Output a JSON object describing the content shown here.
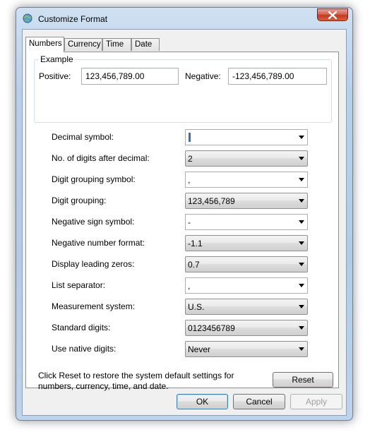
{
  "window": {
    "title": "Customize Format"
  },
  "tabs": [
    {
      "label": "Numbers",
      "active": true
    },
    {
      "label": "Currency",
      "active": false
    },
    {
      "label": "Time",
      "active": false
    },
    {
      "label": "Date",
      "active": false
    }
  ],
  "example": {
    "title": "Example",
    "positive_label": "Positive:",
    "positive_value": "123,456,789.00",
    "negative_label": "Negative:",
    "negative_value": "-123,456,789.00"
  },
  "settings": [
    {
      "label": "Decimal symbol:",
      "value": ".",
      "style": "editable"
    },
    {
      "label": "No. of digits after decimal:",
      "value": "2",
      "style": "readonly"
    },
    {
      "label": "Digit grouping symbol:",
      "value": ",",
      "style": "editable"
    },
    {
      "label": "Digit grouping:",
      "value": "123,456,789",
      "style": "readonly"
    },
    {
      "label": "Negative sign symbol:",
      "value": "-",
      "style": "editable"
    },
    {
      "label": "Negative number format:",
      "value": "-1.1",
      "style": "readonly"
    },
    {
      "label": "Display leading zeros:",
      "value": "0.7",
      "style": "readonly"
    },
    {
      "label": "List separator:",
      "value": ",",
      "style": "editable"
    },
    {
      "label": "Measurement system:",
      "value": "U.S.",
      "style": "readonly"
    },
    {
      "label": "Standard digits:",
      "value": "0123456789",
      "style": "readonly"
    },
    {
      "label": "Use native digits:",
      "value": "Never",
      "style": "readonly"
    }
  ],
  "info": {
    "line1": "Click Reset to restore the system default settings for",
    "line2": "numbers, currency, time, and date."
  },
  "buttons": {
    "reset": "Reset",
    "ok": "OK",
    "cancel": "Cancel",
    "apply": "Apply"
  },
  "colors": {
    "frame": "#b9d0ea",
    "close": "#c13a20",
    "default_button_border": "#3c7fb1"
  }
}
